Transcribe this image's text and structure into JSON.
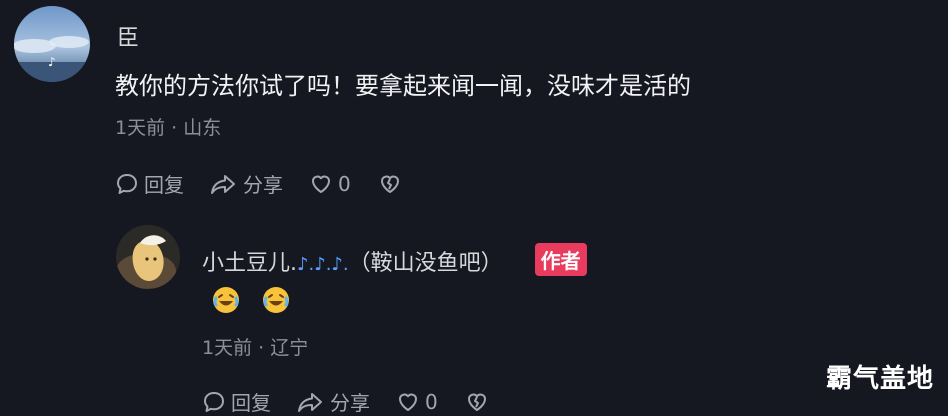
{
  "comment": {
    "username": "臣",
    "text": "教你的方法你试了吗！要拿起来闻一闻，没味才是活的",
    "meta": "1天前 · 山东",
    "reply_label": "回复",
    "share_label": "分享",
    "like_count": "0"
  },
  "reply": {
    "username": "小土豆儿.",
    "username_suffix": "（鞍山没鱼吧）",
    "author_badge": "作者",
    "meta": "1天前 · 辽宁",
    "reply_label": "回复",
    "share_label": "分享",
    "like_count": "0"
  },
  "watermark": "霸气盖地",
  "colors": {
    "background": "#151821",
    "badge": "#e83b5e",
    "meta": "#8c8f98"
  },
  "icons": [
    "comment-bubble-icon",
    "share-arrow-icon",
    "heart-icon",
    "broken-heart-icon",
    "music-note-icon",
    "laughing-emoji-icon"
  ]
}
